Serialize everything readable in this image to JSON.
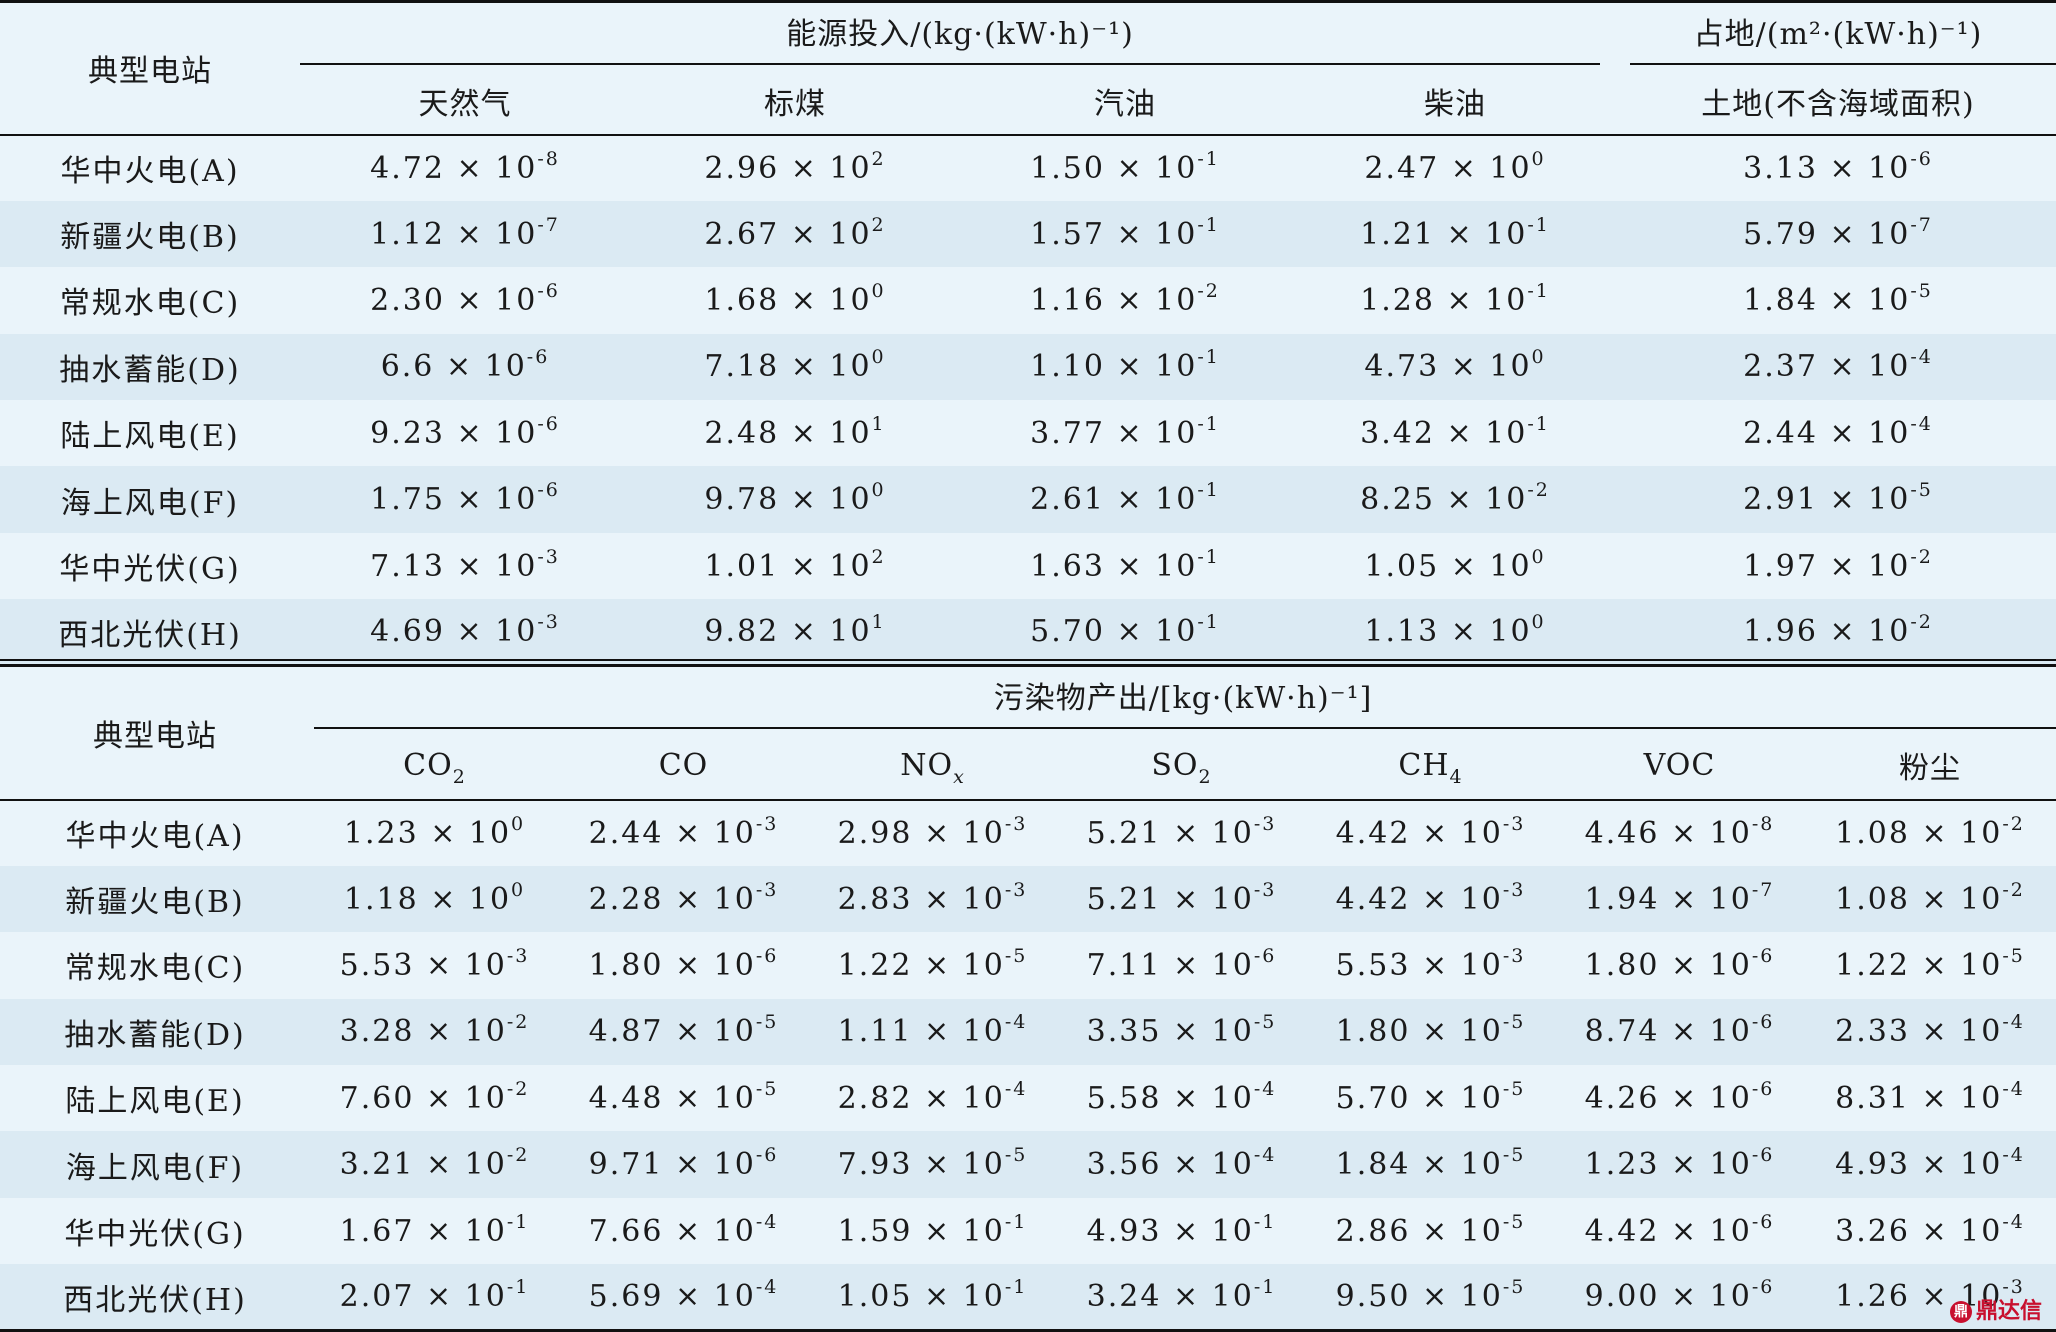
{
  "table1": {
    "station_header": "典型电站",
    "group_energy": "能源投入/(kg·(kW·h)⁻¹)",
    "group_land": "占地/(m²·(kW·h)⁻¹)",
    "columns": [
      "天然气",
      "标煤",
      "汽油",
      "柴油",
      "土地(不含海域面积)"
    ],
    "rows": [
      {
        "label": "华中火电(A)",
        "cells": [
          [
            "4.72",
            "-8"
          ],
          [
            "2.96",
            "2"
          ],
          [
            "1.50",
            "-1"
          ],
          [
            "2.47",
            "0"
          ],
          [
            "3.13",
            "-6"
          ]
        ]
      },
      {
        "label": "新疆火电(B)",
        "cells": [
          [
            "1.12",
            "-7"
          ],
          [
            "2.67",
            "2"
          ],
          [
            "1.57",
            "-1"
          ],
          [
            "1.21",
            "-1"
          ],
          [
            "5.79",
            "-7"
          ]
        ]
      },
      {
        "label": "常规水电(C)",
        "cells": [
          [
            "2.30",
            "-6"
          ],
          [
            "1.68",
            "0"
          ],
          [
            "1.16",
            "-2"
          ],
          [
            "1.28",
            "-1"
          ],
          [
            "1.84",
            "-5"
          ]
        ]
      },
      {
        "label": "抽水蓄能(D)",
        "cells": [
          [
            "6.6",
            "-6"
          ],
          [
            "7.18",
            "0"
          ],
          [
            "1.10",
            "-1"
          ],
          [
            "4.73",
            "0"
          ],
          [
            "2.37",
            "-4"
          ]
        ]
      },
      {
        "label": "陆上风电(E)",
        "cells": [
          [
            "9.23",
            "-6"
          ],
          [
            "2.48",
            "1"
          ],
          [
            "3.77",
            "-1"
          ],
          [
            "3.42",
            "-1"
          ],
          [
            "2.44",
            "-4"
          ]
        ]
      },
      {
        "label": "海上风电(F)",
        "cells": [
          [
            "1.75",
            "-6"
          ],
          [
            "9.78",
            "0"
          ],
          [
            "2.61",
            "-1"
          ],
          [
            "8.25",
            "-2"
          ],
          [
            "2.91",
            "-5"
          ]
        ]
      },
      {
        "label": "华中光伏(G)",
        "cells": [
          [
            "7.13",
            "-3"
          ],
          [
            "1.01",
            "2"
          ],
          [
            "1.63",
            "-1"
          ],
          [
            "1.05",
            "0"
          ],
          [
            "1.97",
            "-2"
          ]
        ]
      },
      {
        "label": "西北光伏(H)",
        "cells": [
          [
            "4.69",
            "-3"
          ],
          [
            "9.82",
            "1"
          ],
          [
            "5.70",
            "-1"
          ],
          [
            "1.13",
            "0"
          ],
          [
            "1.96",
            "-2"
          ]
        ]
      }
    ]
  },
  "table2": {
    "station_header": "典型电站",
    "group_pollutant": "污染物产出/[kg·(kW·h)⁻¹]",
    "columns": [
      {
        "base": "CO",
        "sub": "2"
      },
      {
        "base": "CO",
        "sub": ""
      },
      {
        "base": "NO",
        "sub": "x"
      },
      {
        "base": "SO",
        "sub": "2"
      },
      {
        "base": "CH",
        "sub": "4"
      },
      {
        "base": "VOC",
        "sub": ""
      },
      {
        "base": "粉尘",
        "sub": ""
      }
    ],
    "rows": [
      {
        "label": "华中火电(A)",
        "cells": [
          [
            "1.23",
            "0"
          ],
          [
            "2.44",
            "-3"
          ],
          [
            "2.98",
            "-3"
          ],
          [
            "5.21",
            "-3"
          ],
          [
            "4.42",
            "-3"
          ],
          [
            "4.46",
            "-8"
          ],
          [
            "1.08",
            "-2"
          ]
        ]
      },
      {
        "label": "新疆火电(B)",
        "cells": [
          [
            "1.18",
            "0"
          ],
          [
            "2.28",
            "-3"
          ],
          [
            "2.83",
            "-3"
          ],
          [
            "5.21",
            "-3"
          ],
          [
            "4.42",
            "-3"
          ],
          [
            "1.94",
            "-7"
          ],
          [
            "1.08",
            "-2"
          ]
        ]
      },
      {
        "label": "常规水电(C)",
        "cells": [
          [
            "5.53",
            "-3"
          ],
          [
            "1.80",
            "-6"
          ],
          [
            "1.22",
            "-5"
          ],
          [
            "7.11",
            "-6"
          ],
          [
            "5.53",
            "-3"
          ],
          [
            "1.80",
            "-6"
          ],
          [
            "1.22",
            "-5"
          ]
        ]
      },
      {
        "label": "抽水蓄能(D)",
        "cells": [
          [
            "3.28",
            "-2"
          ],
          [
            "4.87",
            "-5"
          ],
          [
            "1.11",
            "-4"
          ],
          [
            "3.35",
            "-5"
          ],
          [
            "1.80",
            "-5"
          ],
          [
            "8.74",
            "-6"
          ],
          [
            "2.33",
            "-4"
          ]
        ]
      },
      {
        "label": "陆上风电(E)",
        "cells": [
          [
            "7.60",
            "-2"
          ],
          [
            "4.48",
            "-5"
          ],
          [
            "2.82",
            "-4"
          ],
          [
            "5.58",
            "-4"
          ],
          [
            "5.70",
            "-5"
          ],
          [
            "4.26",
            "-6"
          ],
          [
            "8.31",
            "-4"
          ]
        ]
      },
      {
        "label": "海上风电(F)",
        "cells": [
          [
            "3.21",
            "-2"
          ],
          [
            "9.71",
            "-6"
          ],
          [
            "7.93",
            "-5"
          ],
          [
            "3.56",
            "-4"
          ],
          [
            "1.84",
            "-5"
          ],
          [
            "1.23",
            "-6"
          ],
          [
            "4.93",
            "-4"
          ]
        ]
      },
      {
        "label": "华中光伏(G)",
        "cells": [
          [
            "1.67",
            "-1"
          ],
          [
            "7.66",
            "-4"
          ],
          [
            "1.59",
            "-1"
          ],
          [
            "4.93",
            "-1"
          ],
          [
            "2.86",
            "-5"
          ],
          [
            "4.42",
            "-6"
          ],
          [
            "3.26",
            "-4"
          ]
        ]
      },
      {
        "label": "西北光伏(H)",
        "cells": [
          [
            "2.07",
            "-1"
          ],
          [
            "5.69",
            "-4"
          ],
          [
            "1.05",
            "-1"
          ],
          [
            "3.24",
            "-1"
          ],
          [
            "9.50",
            "-5"
          ],
          [
            "9.00",
            "-6"
          ],
          [
            "1.26",
            "-3"
          ]
        ]
      }
    ]
  },
  "watermark": "鼎达信"
}
